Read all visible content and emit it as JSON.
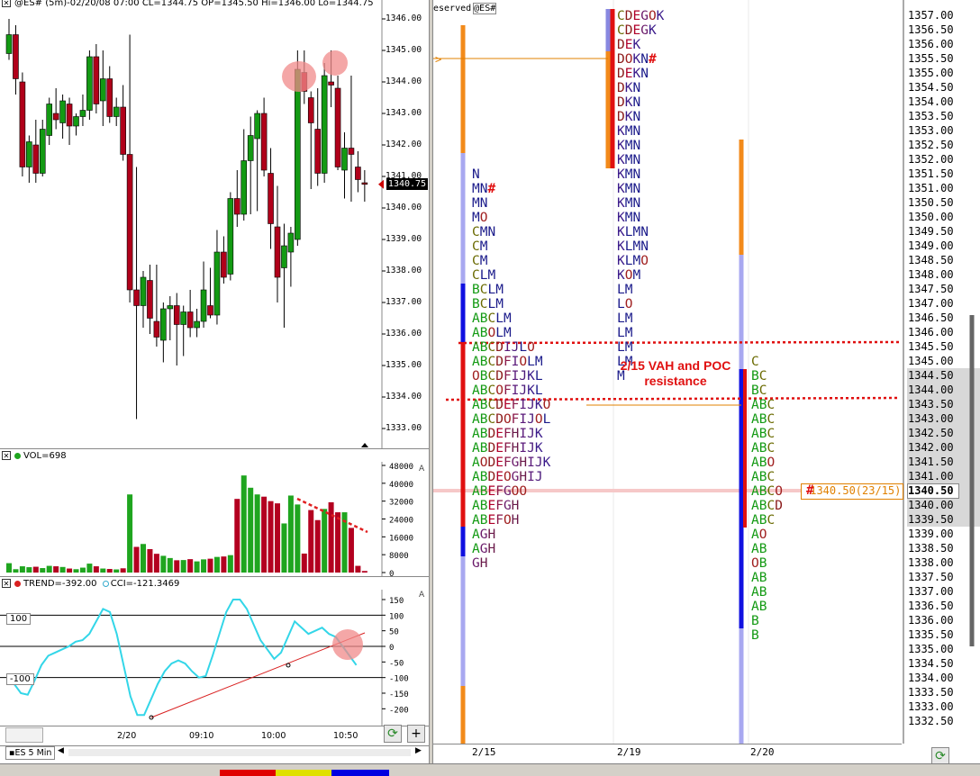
{
  "left": {
    "price_header": "@ES# (5m)-02/20/08 07:00 CL=1344.75 OP=1345.50 Hi=1346.00 Lo=1344.75",
    "price_ticks": [
      "1346.00",
      "1345.00",
      "1344.00",
      "1343.00",
      "1342.00",
      "1341.00",
      "1340.00",
      "1339.00",
      "1338.00",
      "1337.00",
      "1336.00",
      "1335.00",
      "1334.00",
      "1333.00"
    ],
    "last_price": "1340.75",
    "vol_header": "VOL=698",
    "vol_ticks": [
      "48000",
      "40000",
      "32000",
      "24000",
      "16000",
      "8000",
      "0"
    ],
    "cci_header": "TREND=-392.00",
    "cci_header2": "CCI=-121.3469",
    "cci_ticks": [
      "150",
      "100",
      "50",
      "0",
      "-50",
      "-100",
      "-150",
      "-200"
    ],
    "cci_level_hi": "100",
    "cci_level_lo": "-100",
    "time_ticks": [
      "2/20",
      "09:10",
      "10:00",
      "10:50"
    ],
    "tab_label": "ES 5 Min",
    "axis_letter": "A",
    "refresh_icon": "refresh-icon",
    "add_icon": "plus-icon",
    "add_label": "+",
    "colors": {
      "up": "#139a13",
      "down": "#b0001a",
      "vol_up": "#1fa51f",
      "vol_down": "#b30020",
      "cci": "#33d6e8",
      "trend": "#d92020"
    }
  },
  "chart_data": [
    {
      "type": "candlestick",
      "title": "@ES# (5m)-02/20/08 07:00 CL=1344.75 OP=1345.50 Hi=1346.00 Lo=1344.75",
      "ylim": [
        1332.5,
        1346.3
      ],
      "bars": [
        [
          1344.9,
          1346.0,
          1344.7,
          1345.5
        ],
        [
          1345.5,
          1345.8,
          1343.6,
          1344.1
        ],
        [
          1344.0,
          1344.3,
          1341.0,
          1341.3
        ],
        [
          1341.3,
          1342.3,
          1340.8,
          1342.1
        ],
        [
          1342.0,
          1342.8,
          1340.8,
          1341.1
        ],
        [
          1341.1,
          1342.8,
          1341.0,
          1342.5
        ],
        [
          1342.3,
          1343.5,
          1342.0,
          1343.3
        ],
        [
          1343.0,
          1343.8,
          1342.5,
          1342.8
        ],
        [
          1342.7,
          1343.6,
          1342.2,
          1343.4
        ],
        [
          1343.3,
          1343.5,
          1342.0,
          1342.6
        ],
        [
          1342.6,
          1343.0,
          1342.3,
          1342.9
        ],
        [
          1342.9,
          1343.6,
          1342.6,
          1343.1
        ],
        [
          1343.1,
          1345.0,
          1342.8,
          1344.8
        ],
        [
          1344.8,
          1345.2,
          1343.0,
          1343.3
        ],
        [
          1343.4,
          1345.0,
          1342.6,
          1344.1
        ],
        [
          1344.1,
          1344.5,
          1342.7,
          1342.9
        ],
        [
          1342.9,
          1343.5,
          1342.6,
          1343.2
        ],
        [
          1343.2,
          1343.9,
          1341.5,
          1341.7
        ],
        [
          1341.7,
          1345.5,
          1337.0,
          1337.4
        ],
        [
          1337.4,
          1341.3,
          1333.3,
          1336.9
        ],
        [
          1336.9,
          1338.0,
          1336.2,
          1337.8
        ],
        [
          1337.7,
          1338.2,
          1336.0,
          1336.5
        ],
        [
          1336.4,
          1338.2,
          1335.6,
          1335.9
        ],
        [
          1335.8,
          1337.0,
          1335.1,
          1336.8
        ],
        [
          1336.8,
          1337.2,
          1335.8,
          1336.9
        ],
        [
          1336.9,
          1337.3,
          1335.0,
          1336.3
        ],
        [
          1336.3,
          1336.9,
          1335.3,
          1336.7
        ],
        [
          1336.7,
          1337.4,
          1335.9,
          1336.2
        ],
        [
          1336.2,
          1336.8,
          1335.9,
          1336.4
        ],
        [
          1336.4,
          1338.3,
          1336.2,
          1337.4
        ],
        [
          1336.9,
          1338.1,
          1336.5,
          1336.6
        ],
        [
          1336.6,
          1339.3,
          1336.3,
          1338.6
        ],
        [
          1338.6,
          1339.1,
          1337.6,
          1337.8
        ],
        [
          1337.9,
          1340.5,
          1337.7,
          1340.3
        ],
        [
          1340.3,
          1341.2,
          1339.4,
          1339.8
        ],
        [
          1339.8,
          1342.5,
          1339.6,
          1341.5
        ],
        [
          1341.5,
          1342.9,
          1339.8,
          1342.3
        ],
        [
          1342.2,
          1343.1,
          1339.9,
          1343.0
        ],
        [
          1343.0,
          1343.5,
          1341.0,
          1341.2
        ],
        [
          1341.1,
          1341.9,
          1338.7,
          1339.5
        ],
        [
          1339.4,
          1340.7,
          1337.0,
          1337.8
        ],
        [
          1338.1,
          1339.5,
          1336.2,
          1338.8
        ],
        [
          1338.6,
          1339.4,
          1337.5,
          1339.2
        ],
        [
          1339.0,
          1345.0,
          1338.8,
          1344.4
        ],
        [
          1344.3,
          1345.0,
          1343.3,
          1343.7
        ],
        [
          1343.5,
          1343.7,
          1340.6,
          1342.7
        ],
        [
          1342.5,
          1343.8,
          1340.7,
          1341.1
        ],
        [
          1341.1,
          1344.6,
          1340.8,
          1344.2
        ],
        [
          1344.0,
          1345.0,
          1343.2,
          1343.9
        ],
        [
          1343.8,
          1344.2,
          1341.2,
          1341.3
        ],
        [
          1341.2,
          1342.4,
          1340.3,
          1341.9
        ],
        [
          1341.9,
          1344.2,
          1340.2,
          1341.7
        ],
        [
          1341.3,
          1341.8,
          1340.5,
          1340.9
        ],
        [
          1340.8,
          1341.2,
          1340.2,
          1340.75
        ]
      ]
    },
    {
      "type": "bar",
      "title": "VOL=698",
      "ylim": [
        0,
        50000
      ],
      "values": [
        4200,
        1500,
        2800,
        2400,
        2600,
        2000,
        3000,
        2800,
        2500,
        1800,
        1500,
        2200,
        4000,
        2800,
        1800,
        1600,
        1400,
        1900,
        35000,
        11500,
        12800,
        10500,
        8400,
        7500,
        6500,
        5500,
        5600,
        6000,
        5000,
        5900,
        6200,
        7000,
        7200,
        7800,
        33000,
        43500,
        38000,
        35000,
        34000,
        32000,
        31000,
        22000,
        34500,
        30500,
        8500,
        28000,
        23500,
        28500,
        31500,
        27000,
        27000,
        20000,
        3000,
        700
      ],
      "up": [
        1,
        1,
        1,
        1,
        0,
        1,
        1,
        0,
        1,
        0,
        1,
        1,
        1,
        0,
        1,
        0,
        1,
        0,
        1,
        0,
        1,
        0,
        0,
        1,
        1,
        0,
        1,
        0,
        1,
        1,
        0,
        1,
        0,
        1,
        0,
        1,
        1,
        1,
        0,
        0,
        0,
        1,
        1,
        1,
        0,
        0,
        0,
        1,
        0,
        0,
        1,
        0,
        0,
        0
      ]
    },
    {
      "type": "line",
      "title": "CCI=-121.3469",
      "ylim": [
        -230,
        170
      ],
      "series": [
        {
          "name": "CCI",
          "values": [
            -90,
            -120,
            -150,
            -155,
            -110,
            -60,
            -30,
            -20,
            -10,
            0,
            15,
            20,
            40,
            80,
            120,
            110,
            40,
            -60,
            -160,
            -220,
            -220,
            -170,
            -120,
            -80,
            -55,
            -45,
            -55,
            -80,
            -100,
            -95,
            -30,
            40,
            110,
            150,
            150,
            120,
            70,
            20,
            -10,
            -40,
            -20,
            30,
            80,
            60,
            40,
            50,
            60,
            40,
            30,
            0,
            -30,
            -60
          ]
        }
      ]
    }
  ],
  "right": {
    "header_text": "eserved",
    "header_symbol": "@ES#",
    "date_labels": [
      "2/15",
      "2/19",
      "2/20"
    ],
    "price_ticks": [
      "1357.00",
      "1356.50",
      "1356.00",
      "1355.50",
      "1355.00",
      "1354.50",
      "1354.00",
      "1353.50",
      "1353.00",
      "1352.50",
      "1352.00",
      "1351.50",
      "1351.00",
      "1350.50",
      "1350.00",
      "1349.50",
      "1349.00",
      "1348.50",
      "1348.00",
      "1347.50",
      "1347.00",
      "1346.50",
      "1346.00",
      "1345.50",
      "1345.00",
      "1344.50",
      "1344.00",
      "1343.50",
      "1343.00",
      "1342.50",
      "1342.00",
      "1341.50",
      "1341.00",
      "1340.50",
      "1340.00",
      "1339.50",
      "1339.00",
      "1338.50",
      "1338.00",
      "1337.50",
      "1337.00",
      "1336.50",
      "1336.00",
      "1335.50",
      "1335.00",
      "1334.50",
      "1334.00",
      "1333.50",
      "1333.00",
      "1332.50"
    ],
    "current_price_tag": "1340.50",
    "annotation": "2/15 VAH and POC resistance",
    "poc_label": "1340.50(23/15)",
    "poc_hash": "#",
    "profile_2_15": [
      "N",
      "MN#",
      "MN",
      "MO",
      "CMN",
      "CM",
      "CM",
      "CLM",
      "BCLM",
      "BCLM",
      "ABCLM",
      "ABOLM",
      "ABCDIJLO",
      "ABCDFIOLM",
      "OBCDFIJKL",
      "ABCOFIJKL",
      "ABCDEFIJKO",
      "ABCDOFIJOL",
      "ABDEFHIJK",
      "ABDEFHIJK",
      "AODEFGHIJK",
      "ABDEOGHIJ",
      "ABEFGOO",
      "ABEFGH",
      "ABEFOH",
      "AGH",
      "AGH",
      "GH"
    ],
    "profile_2_19": [
      "CDEGOK",
      "CDEGK",
      "DEK",
      "DOKN#",
      "DEKN",
      "DKN",
      "DKN",
      "DKN",
      "KMN",
      "KMN",
      "KMN",
      "KMN",
      "KMN",
      "KMN",
      "KMN",
      "KLMN",
      "KLMN",
      "KLMO",
      "KOM",
      "LM",
      "LO",
      "LM",
      "LM",
      "LM",
      "LM",
      "M"
    ],
    "profile_2_20": [
      "C",
      "BC",
      "BC",
      "ABC",
      "ABC",
      "ABC",
      "ABC",
      "ABO",
      "ABC",
      "ABCO",
      "ABCD",
      "ABC",
      "AO",
      "AB",
      "OB",
      "AB",
      "AB",
      "AB",
      "B",
      "B"
    ],
    "refresh_icon": "refresh-icon"
  }
}
